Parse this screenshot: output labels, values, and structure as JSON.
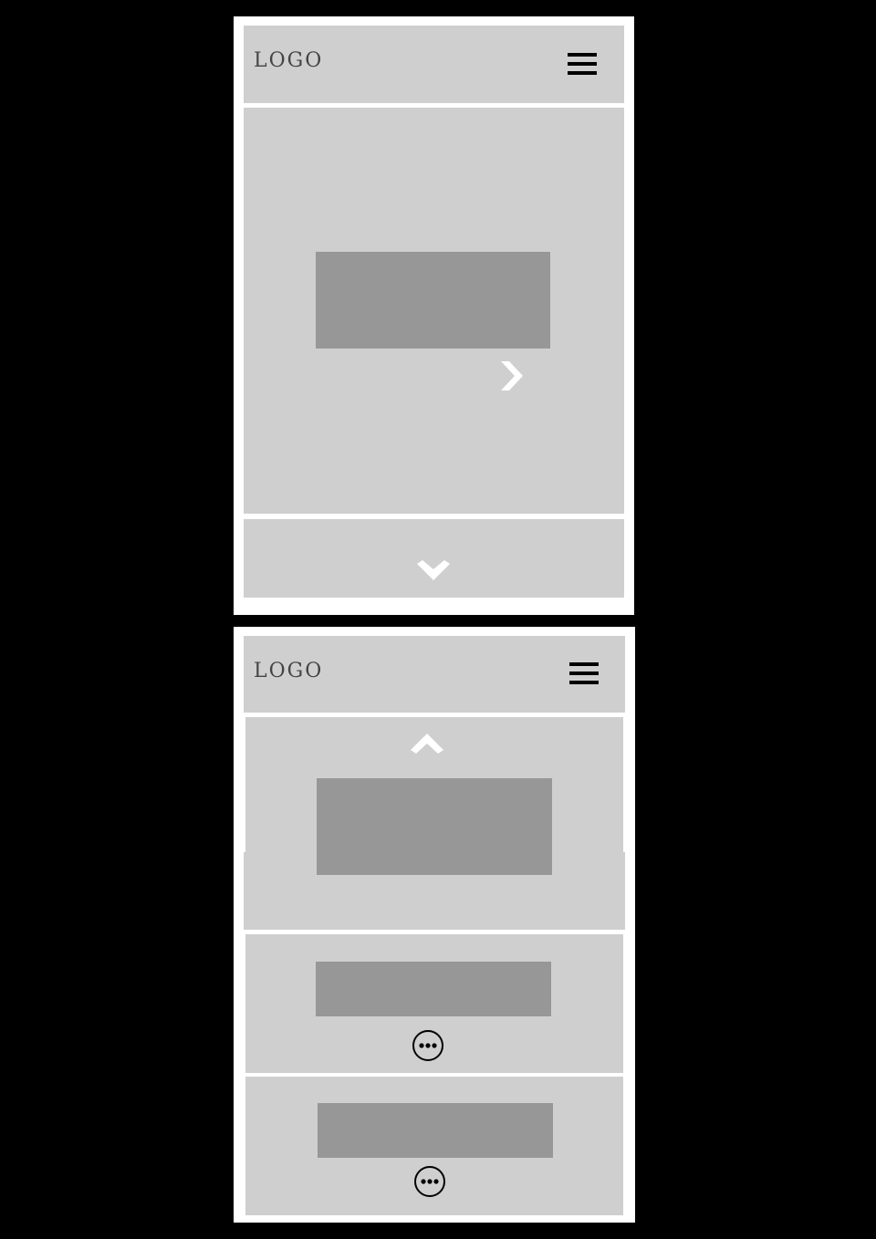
{
  "screens": [
    {
      "header": {
        "logo": "LOGO",
        "menu_icon": "hamburger-menu-icon"
      },
      "hero": {
        "next_icon": "chevron-right-icon"
      },
      "footer": {
        "scroll_icon": "chevron-down-icon"
      }
    },
    {
      "header": {
        "logo": "LOGO",
        "menu_icon": "hamburger-menu-icon"
      },
      "hero": {
        "scroll_icon": "chevron-up-icon"
      },
      "cards": [
        {
          "more_icon": "more-options-icon"
        },
        {
          "more_icon": "more-options-icon"
        }
      ]
    }
  ],
  "colors": {
    "background": "#000000",
    "frame": "#ffffff",
    "panel": "#cfcfcf",
    "placeholder": "#979797",
    "icon_light": "#ffffff",
    "icon_dark": "#000000"
  }
}
